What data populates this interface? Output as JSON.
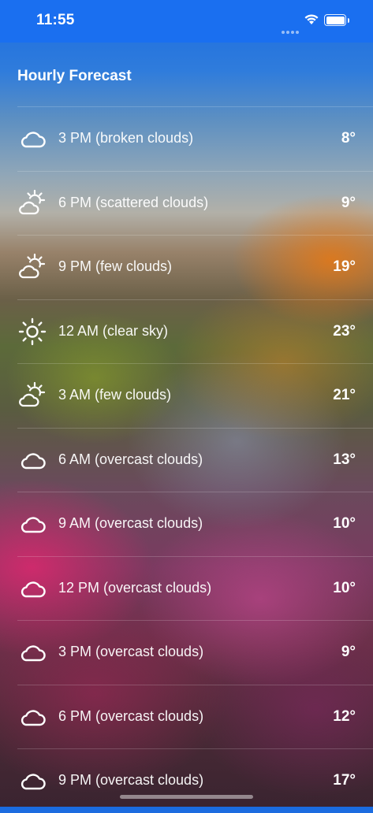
{
  "status_bar": {
    "time": "11:55"
  },
  "header": {
    "title": "Hourly Forecast"
  },
  "forecast": [
    {
      "label": "3 PM (broken clouds)",
      "temp": "8°",
      "icon": "cloud-icon"
    },
    {
      "label": "6 PM (scattered clouds)",
      "temp": "9°",
      "icon": "partly-sunny-icon"
    },
    {
      "label": "9 PM (few clouds)",
      "temp": "19°",
      "icon": "partly-sunny-icon"
    },
    {
      "label": "12 AM (clear sky)",
      "temp": "23°",
      "icon": "sun-icon"
    },
    {
      "label": "3 AM (few clouds)",
      "temp": "21°",
      "icon": "partly-sunny-icon"
    },
    {
      "label": "6 AM (overcast clouds)",
      "temp": "13°",
      "icon": "cloud-icon"
    },
    {
      "label": "9 AM (overcast clouds)",
      "temp": "10°",
      "icon": "cloud-icon"
    },
    {
      "label": "12 PM (overcast clouds)",
      "temp": "10°",
      "icon": "cloud-icon"
    },
    {
      "label": "3 PM (overcast clouds)",
      "temp": "9°",
      "icon": "cloud-icon"
    },
    {
      "label": "6 PM (overcast clouds)",
      "temp": "12°",
      "icon": "cloud-icon"
    },
    {
      "label": "9 PM (overcast clouds)",
      "temp": "17°",
      "icon": "cloud-icon"
    }
  ]
}
